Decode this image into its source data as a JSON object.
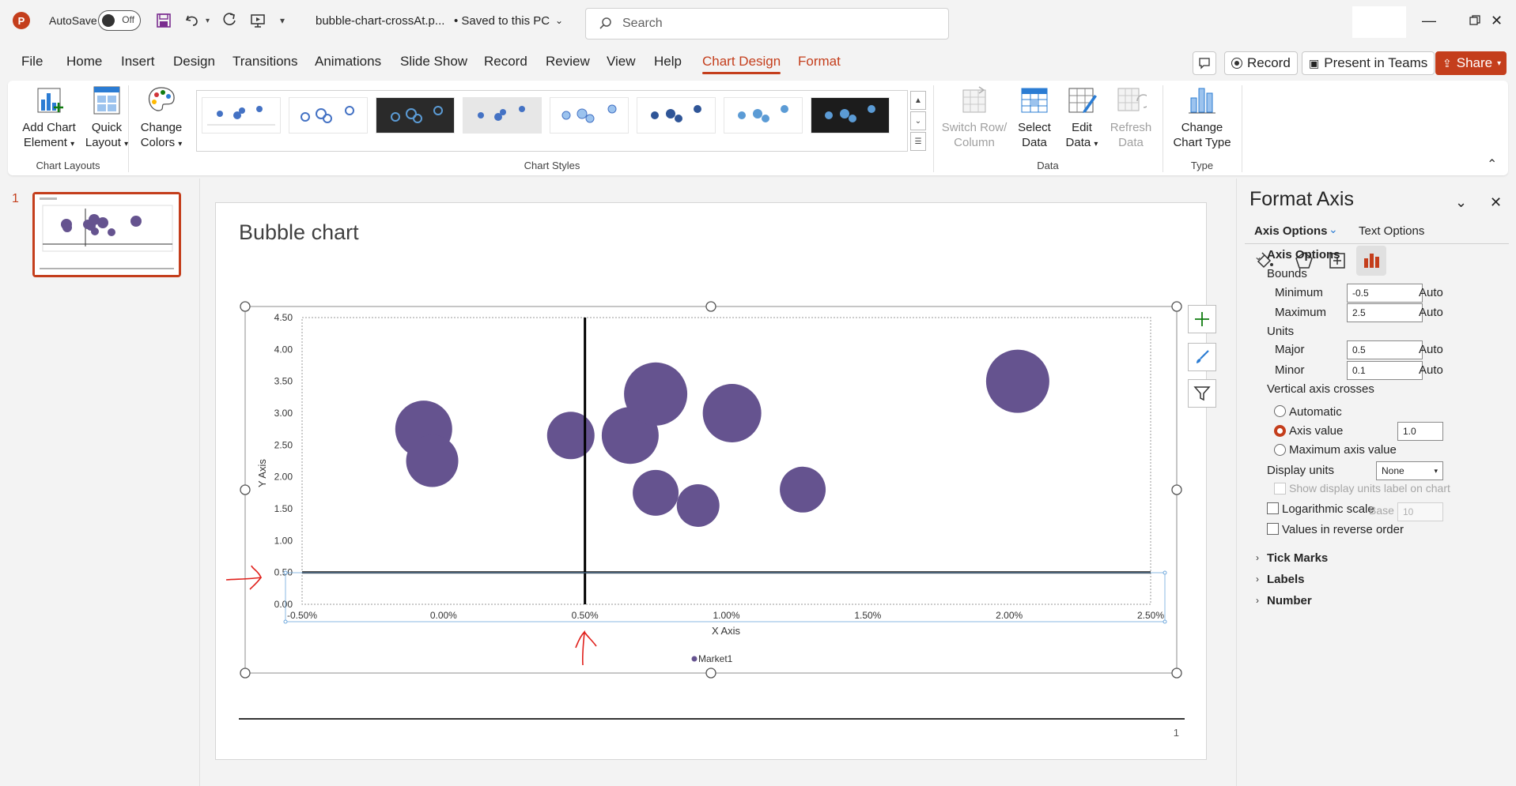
{
  "app": {
    "autosave_label": "AutoSave",
    "autosave_state": "Off",
    "file_title": "bubble-chart-crossAt.p...",
    "save_state": "• Saved to this PC",
    "search_placeholder": "Search"
  },
  "menu": {
    "tabs": [
      "File",
      "Home",
      "Insert",
      "Design",
      "Transitions",
      "Animations",
      "Slide Show",
      "Record",
      "Review",
      "View",
      "Help",
      "Chart Design",
      "Format"
    ],
    "record_btn": "Record",
    "present_btn": "Present in Teams",
    "share_btn": "Share"
  },
  "ribbon": {
    "add_chart_element_1": "Add Chart",
    "add_chart_element_2": "Element",
    "quick_layout_1": "Quick",
    "quick_layout_2": "Layout",
    "change_colors_1": "Change",
    "change_colors_2": "Colors",
    "group_chart_layouts": "Chart Layouts",
    "group_chart_styles": "Chart Styles",
    "switch_row_1": "Switch Row/",
    "switch_row_2": "Column",
    "select_data_1": "Select",
    "select_data_2": "Data",
    "edit_data_1": "Edit",
    "edit_data_2": "Data",
    "refresh_data_1": "Refresh",
    "refresh_data_2": "Data",
    "group_data": "Data",
    "change_type_1": "Change",
    "change_type_2": "Chart Type",
    "group_type": "Type"
  },
  "thumbs": {
    "slide_number": "1"
  },
  "slide": {
    "title": "Bubble chart",
    "page_number": "1"
  },
  "chart_data": {
    "type": "bubble",
    "xlabel": "X Axis",
    "ylabel": "Y Axis",
    "xlim": [
      -0.005,
      0.025
    ],
    "ylim": [
      0,
      4.5
    ],
    "x_ticks": [
      "-0.50%",
      "0.00%",
      "0.50%",
      "1.00%",
      "1.50%",
      "2.00%",
      "2.50%"
    ],
    "y_ticks": [
      "0.00",
      "0.50",
      "1.00",
      "1.50",
      "2.00",
      "2.50",
      "3.00",
      "3.50",
      "4.00",
      "4.50"
    ],
    "vertical_axis_crosses_at_x": 0.005,
    "horizontal_axis_crosses_at_y": 0.5,
    "grid": false,
    "legend_position": "bottom",
    "color": "#65538f",
    "series": [
      {
        "name": "Market1",
        "x": [
          -0.0007,
          -0.0004,
          0.0045,
          0.0066,
          0.0075,
          0.0102,
          0.0075,
          0.009,
          0.0127,
          0.0203
        ],
        "y": [
          2.75,
          2.25,
          2.65,
          2.65,
          3.3,
          3.0,
          1.75,
          1.55,
          1.8,
          3.5
        ],
        "size": [
          36,
          33,
          30,
          36,
          40,
          37,
          29,
          27,
          29,
          40
        ]
      }
    ]
  },
  "format_pane": {
    "title": "Format Axis",
    "tab_axis_options": "Axis Options",
    "tab_text_options": "Text Options",
    "section_axis_options": "Axis Options",
    "bounds": "Bounds",
    "minimum_label": "Minimum",
    "minimum_value": "-0.5",
    "maximum_label": "Maximum",
    "maximum_value": "2.5",
    "units": "Units",
    "major_label": "Major",
    "major_value": "0.5",
    "minor_label": "Minor",
    "minor_value": "0.1",
    "auto": "Auto",
    "vertical_axis_crosses": "Vertical axis crosses",
    "opt_automatic": "Automatic",
    "opt_axis_value": "Axis value",
    "axis_value": "1.0",
    "opt_max_axis_value": "Maximum axis value",
    "display_units_label": "Display units",
    "display_units_value": "None",
    "show_units_label": "Show display units label on chart",
    "log_scale": "Logarithmic scale",
    "base_label": "Base",
    "base_value": "10",
    "reverse_order": "Values in reverse order",
    "tick_marks": "Tick Marks",
    "labels": "Labels",
    "number": "Number"
  },
  "colors": {
    "accent": "#c43e1c",
    "bubble": "#65538f",
    "annotation": "#e0201b"
  }
}
